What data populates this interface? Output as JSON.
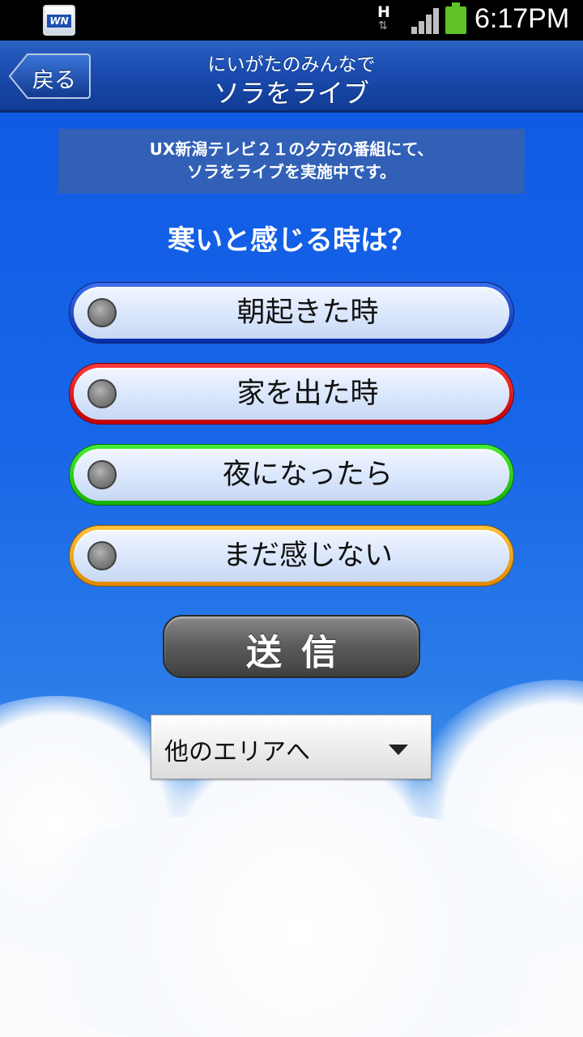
{
  "status_bar": {
    "app_icon_text": "WN",
    "network_type": "H",
    "network_arrows": "⇅",
    "time": "6:17PM",
    "icons": [
      "weathernews-app-icon",
      "signal-icon",
      "battery-icon"
    ]
  },
  "header": {
    "back_label": "戻る",
    "subtitle": "にいがたのみんなで",
    "title": "ソラをライブ"
  },
  "notice": {
    "line1": "UX新潟テレビ２１の夕方の番組にて、",
    "line2": "ソラをライブを実施中です。"
  },
  "question": "寒いと感じる時は？",
  "options": [
    {
      "label": "朝起きた時",
      "color": "#1a3fc8"
    },
    {
      "label": "家を出た時",
      "color": "#e01010"
    },
    {
      "label": "夜になったら",
      "color": "#2ad114"
    },
    {
      "label": "まだ感じない",
      "color": "#f0a010"
    }
  ],
  "send_label": "送信",
  "area_select": {
    "selected": "他のエリアへ"
  },
  "colors": {
    "sky_top": "#0f5be4",
    "header": "#1a4bae",
    "notice_bg": "#3160b6"
  }
}
